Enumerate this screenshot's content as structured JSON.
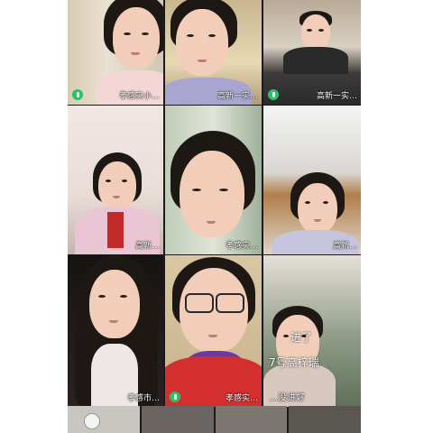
{
  "tiles": [
    {
      "label": "孝感实小…",
      "mic": true
    },
    {
      "label": "高新一实…",
      "mic": false
    },
    {
      "label": "高新一实…",
      "mic": true
    },
    {
      "label": "高新…",
      "mic": false
    },
    {
      "label": "孝感实…",
      "mic": false
    },
    {
      "label": "高新…",
      "mic": false
    },
    {
      "label": "孝感市…",
      "mic": false
    },
    {
      "label": "孝感实…",
      "mic": true
    },
    {
      "label": "…没讲好",
      "mic": false
    }
  ],
  "chat_overlay": [
    "进了",
    "7号高梓瑞"
  ],
  "colors": {
    "mic_active": "#2cc06a",
    "background": "#1b1b1b"
  }
}
